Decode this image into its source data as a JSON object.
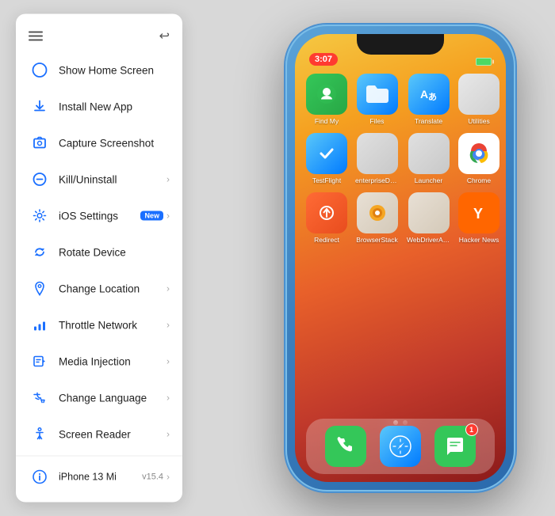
{
  "sidebar": {
    "items": [
      {
        "id": "show-home",
        "label": "Show Home Screen",
        "icon": "circle-outline",
        "hasChevron": false
      },
      {
        "id": "install-app",
        "label": "Install New App",
        "icon": "download",
        "hasChevron": false
      },
      {
        "id": "capture-screenshot",
        "label": "Capture Screenshot",
        "icon": "screenshot",
        "hasChevron": false
      },
      {
        "id": "kill-uninstall",
        "label": "Kill/Uninstall",
        "icon": "circle-minus",
        "hasChevron": true
      },
      {
        "id": "ios-settings",
        "label": "iOS Settings",
        "icon": "gear",
        "hasChevron": true,
        "badge": "New"
      },
      {
        "id": "rotate-device",
        "label": "Rotate Device",
        "icon": "rotate",
        "hasChevron": false
      },
      {
        "id": "change-location",
        "label": "Change Location",
        "icon": "location",
        "hasChevron": true
      },
      {
        "id": "throttle-network",
        "label": "Throttle Network",
        "icon": "signal",
        "hasChevron": true
      },
      {
        "id": "media-injection",
        "label": "Media Injection",
        "icon": "media",
        "hasChevron": true
      },
      {
        "id": "change-language",
        "label": "Change Language",
        "icon": "language",
        "hasChevron": true
      },
      {
        "id": "screen-reader",
        "label": "Screen Reader",
        "icon": "accessibility",
        "hasChevron": true
      }
    ],
    "device": {
      "label": "iPhone 13 Mi",
      "version": "v15.4"
    }
  },
  "phone": {
    "time": "3:07",
    "apps_row1": [
      {
        "name": "Find My",
        "class": "app-findmy"
      },
      {
        "name": "Files",
        "class": "app-files"
      },
      {
        "name": "Translate",
        "class": "app-translate"
      },
      {
        "name": "Utilities",
        "class": "app-utilities"
      }
    ],
    "apps_row2": [
      {
        "name": "TestFlight",
        "class": "app-testflight"
      },
      {
        "name": "enterpriseDum...",
        "class": "app-enterprise"
      },
      {
        "name": "Launcher",
        "class": "app-launcher"
      },
      {
        "name": "Chrome",
        "class": "app-chrome"
      }
    ],
    "apps_row3": [
      {
        "name": "Redirect",
        "class": "app-redirect"
      },
      {
        "name": "BrowserStack",
        "class": "app-browserstack"
      },
      {
        "name": "WebDriverAge...",
        "class": "app-webdriver"
      },
      {
        "name": "Hacker News",
        "class": "app-hackernews"
      }
    ],
    "dock": [
      {
        "name": "Phone",
        "class": "dock-phone",
        "badge": null
      },
      {
        "name": "Safari",
        "class": "dock-safari",
        "badge": null
      },
      {
        "name": "Messages",
        "class": "dock-messages",
        "badge": "1"
      }
    ]
  }
}
